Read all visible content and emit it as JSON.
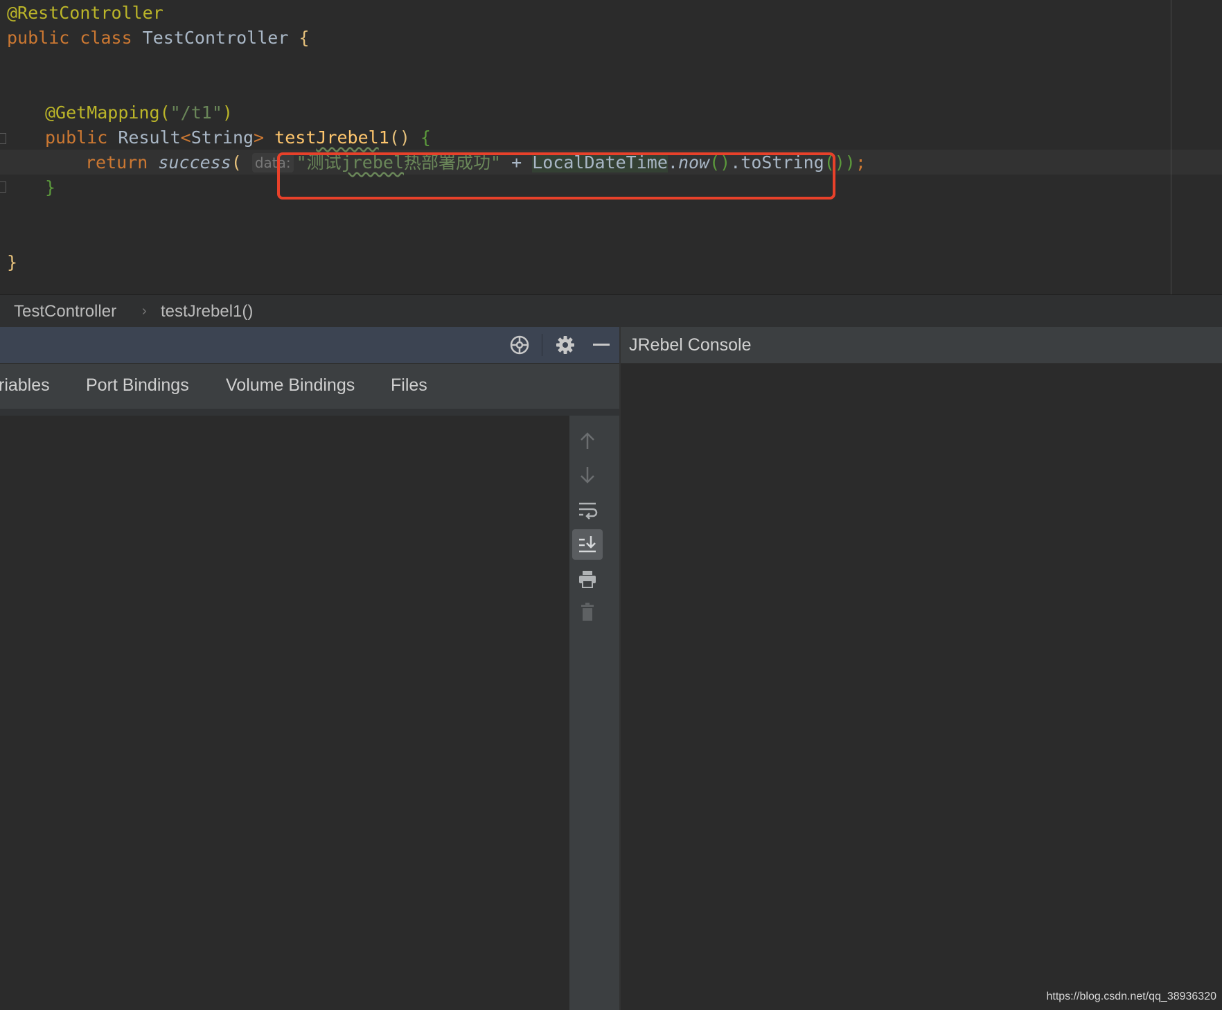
{
  "editor": {
    "lines": {
      "l1": "@RestController",
      "l2_kw": "public class ",
      "l2_name": "TestController",
      "l2_brace": " {",
      "l3_ann": "@GetMapping(",
      "l3_str": "\"/t1\"",
      "l3_close": ")",
      "l4_kw": "public ",
      "l4_type": "Result",
      "l4_lt": "<",
      "l4_generic": "String",
      "l4_gt": ">",
      "l4_fn_a": "test",
      "l4_fn_b": "Jrebel",
      "l4_fn_c": "1",
      "l4_parens": "()",
      "l4_brace": " {",
      "l5_kw": "return ",
      "l5_call": "success",
      "l5_open": "( ",
      "l5_hint": "data:",
      "l5_str_a": "\"测试",
      "l5_str_b": "jrebel",
      "l5_str_c": "热部署成功\"",
      "l5_plus": " + ",
      "l5_class": "LocalDateTime",
      "l5_dot1": ".",
      "l5_now": "now",
      "l5_p1": "()",
      "l5_dot2": ".",
      "l5_tostr": "toString",
      "l5_p2": "())",
      "l5_semi": ";",
      "l6": "}",
      "l7": "}"
    }
  },
  "breadcrumb": {
    "item1": "TestController",
    "separator": "›",
    "item2": "testJrebel1()"
  },
  "left_panel": {
    "tabs": [
      "riables",
      "Port Bindings",
      "Volume Bindings",
      "Files"
    ],
    "header_icons": [
      "crosshair-icon",
      "gear-icon",
      "minimize-icon"
    ],
    "tool_icons": [
      "arrow-up-icon",
      "arrow-down-icon",
      "soft-wrap-icon",
      "scroll-to-end-icon",
      "print-icon",
      "trash-icon"
    ]
  },
  "right_panel": {
    "title": "JRebel Console"
  },
  "watermark": "https://blog.csdn.net/qq_38936320",
  "colors": {
    "background": "#2b2b2b",
    "highlight_box": "#e8412a",
    "annotation": "#bbb529",
    "keyword": "#cc7832",
    "string": "#6a8759",
    "method": "#ffc66d"
  }
}
